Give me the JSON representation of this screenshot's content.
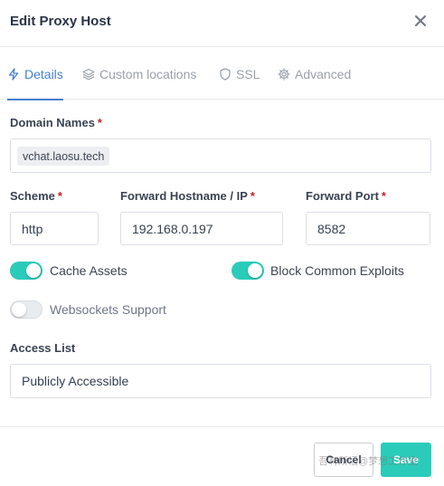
{
  "header": {
    "title": "Edit Proxy Host",
    "close_icon": "close-icon"
  },
  "tabs": [
    {
      "label": "Details",
      "icon": "bolt-icon",
      "active": true
    },
    {
      "label": "Custom locations",
      "icon": "layers-icon",
      "active": false
    },
    {
      "label": "SSL",
      "icon": "shield-icon",
      "active": false
    },
    {
      "label": "Advanced",
      "icon": "gear-icon",
      "active": false
    }
  ],
  "form": {
    "domain_names": {
      "label": "Domain Names",
      "required": "*",
      "chips": [
        "vchat.laosu.tech"
      ]
    },
    "scheme": {
      "label": "Scheme",
      "required": "*",
      "value": "http"
    },
    "forward_hostname": {
      "label": "Forward Hostname / IP",
      "required": "*",
      "value": "192.168.0.197"
    },
    "forward_port": {
      "label": "Forward Port",
      "required": "*",
      "value": "8582"
    },
    "cache_assets": {
      "label": "Cache Assets",
      "enabled": true
    },
    "block_exploits": {
      "label": "Block Common Exploits",
      "enabled": true
    },
    "websockets": {
      "label": "Websockets Support",
      "enabled": false
    },
    "access_list": {
      "label": "Access List",
      "value": "Publicly Accessible"
    }
  },
  "footer": {
    "cancel_label": "Cancel",
    "save_label": "Save",
    "watermark": "吾有所悟@梦想工作室"
  },
  "colors": {
    "accent": "#2bcbba",
    "tab_active": "#467fcf",
    "required": "#cd201f"
  }
}
